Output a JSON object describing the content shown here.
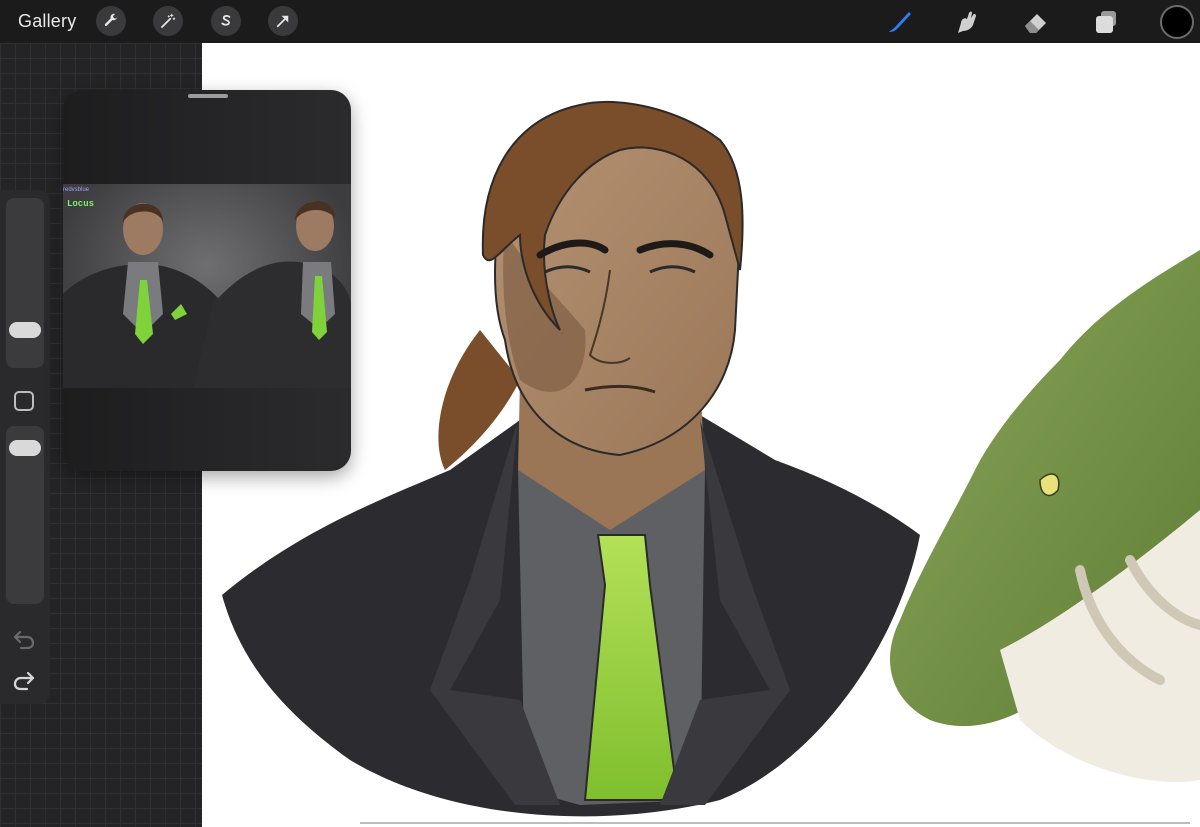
{
  "topbar": {
    "gallery_label": "Gallery",
    "left_tools": [
      "wrench-icon",
      "magic-wand-icon",
      "selection-s-icon",
      "transform-arrow-icon"
    ],
    "right_tools": [
      "brush-icon",
      "smudge-icon",
      "eraser-icon",
      "layers-icon"
    ],
    "active_tool": "brush-icon",
    "current_color": "#000000",
    "accent_color": "#2f7cf6"
  },
  "sidebar": {
    "brush_size_level": 0.2,
    "opacity_level": 0.95
  },
  "reference": {
    "logo_text": "redvsblue",
    "character_label": "Locus"
  }
}
